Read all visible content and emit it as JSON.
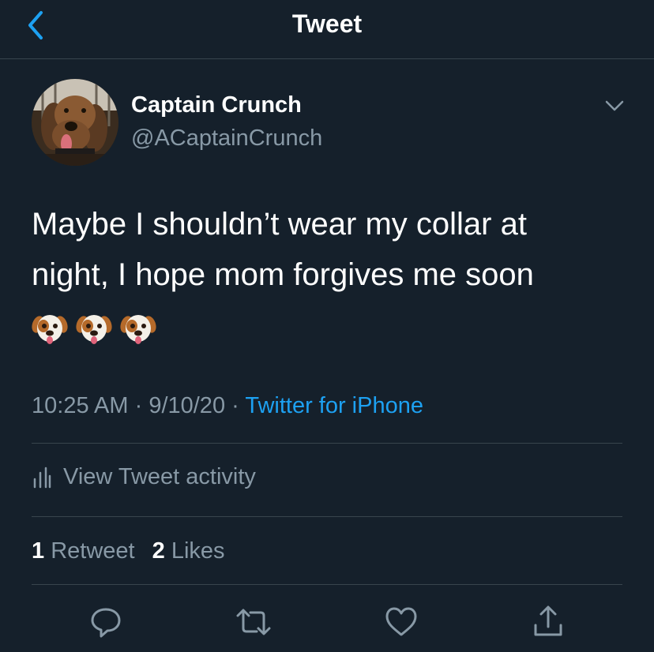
{
  "header": {
    "title": "Tweet"
  },
  "author": {
    "name": "Captain Crunch",
    "handle": "@ACaptainCrunch"
  },
  "tweet": {
    "line1": "Maybe I shouldn’t wear my collar at",
    "line2": "night, I hope mom forgives me soon",
    "emojis": [
      "dog-face-icon",
      "dog-face-icon",
      "dog-face-icon"
    ]
  },
  "meta": {
    "time": "10:25 AM",
    "sep1": " · ",
    "date": "9/10/20",
    "sep2": " · ",
    "source": "Twitter for iPhone"
  },
  "activity": {
    "label": "View Tweet activity"
  },
  "stats": {
    "retweets_count": "1",
    "retweets_label": "Retweet",
    "likes_count": "2",
    "likes_label": "Likes"
  },
  "actions": [
    "reply-icon",
    "retweet-icon",
    "like-icon",
    "share-icon"
  ],
  "colors": {
    "background": "#15202b",
    "secondary_text": "#8899a6",
    "accent": "#1da1f2",
    "divider": "#38444d"
  }
}
